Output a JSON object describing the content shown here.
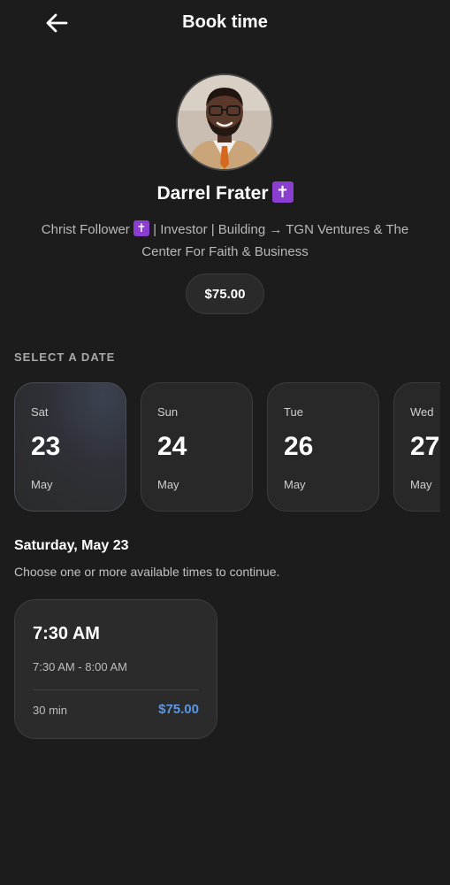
{
  "header": {
    "title": "Book time",
    "back_icon": "arrow-left-icon"
  },
  "profile": {
    "name": "Darrel Frater",
    "badge_glyph": "✝",
    "bio_part1": "Christ Follower",
    "bio_part2": " | Investor | Building → TGN Ventures & The Center For Faith & Business",
    "price": "$75.00"
  },
  "dates": {
    "label": "SELECT A DATE",
    "items": [
      {
        "dow": "Sat",
        "day": "23",
        "month": "May",
        "selected": true
      },
      {
        "dow": "Sun",
        "day": "24",
        "month": "May",
        "selected": false
      },
      {
        "dow": "Tue",
        "day": "26",
        "month": "May",
        "selected": false
      },
      {
        "dow": "Wed",
        "day": "27",
        "month": "May",
        "selected": false
      }
    ]
  },
  "schedule": {
    "selected_date": "Saturday, May 23",
    "helper": "Choose one or more available times to continue.",
    "slots": [
      {
        "time": "7:30 AM",
        "range": "7:30 AM - 8:00 AM",
        "duration": "30 min",
        "price": "$75.00"
      }
    ]
  },
  "colors": {
    "background": "#1c1c1c",
    "badge_purple": "#8a3fd1",
    "price_blue": "#5b97e5"
  }
}
